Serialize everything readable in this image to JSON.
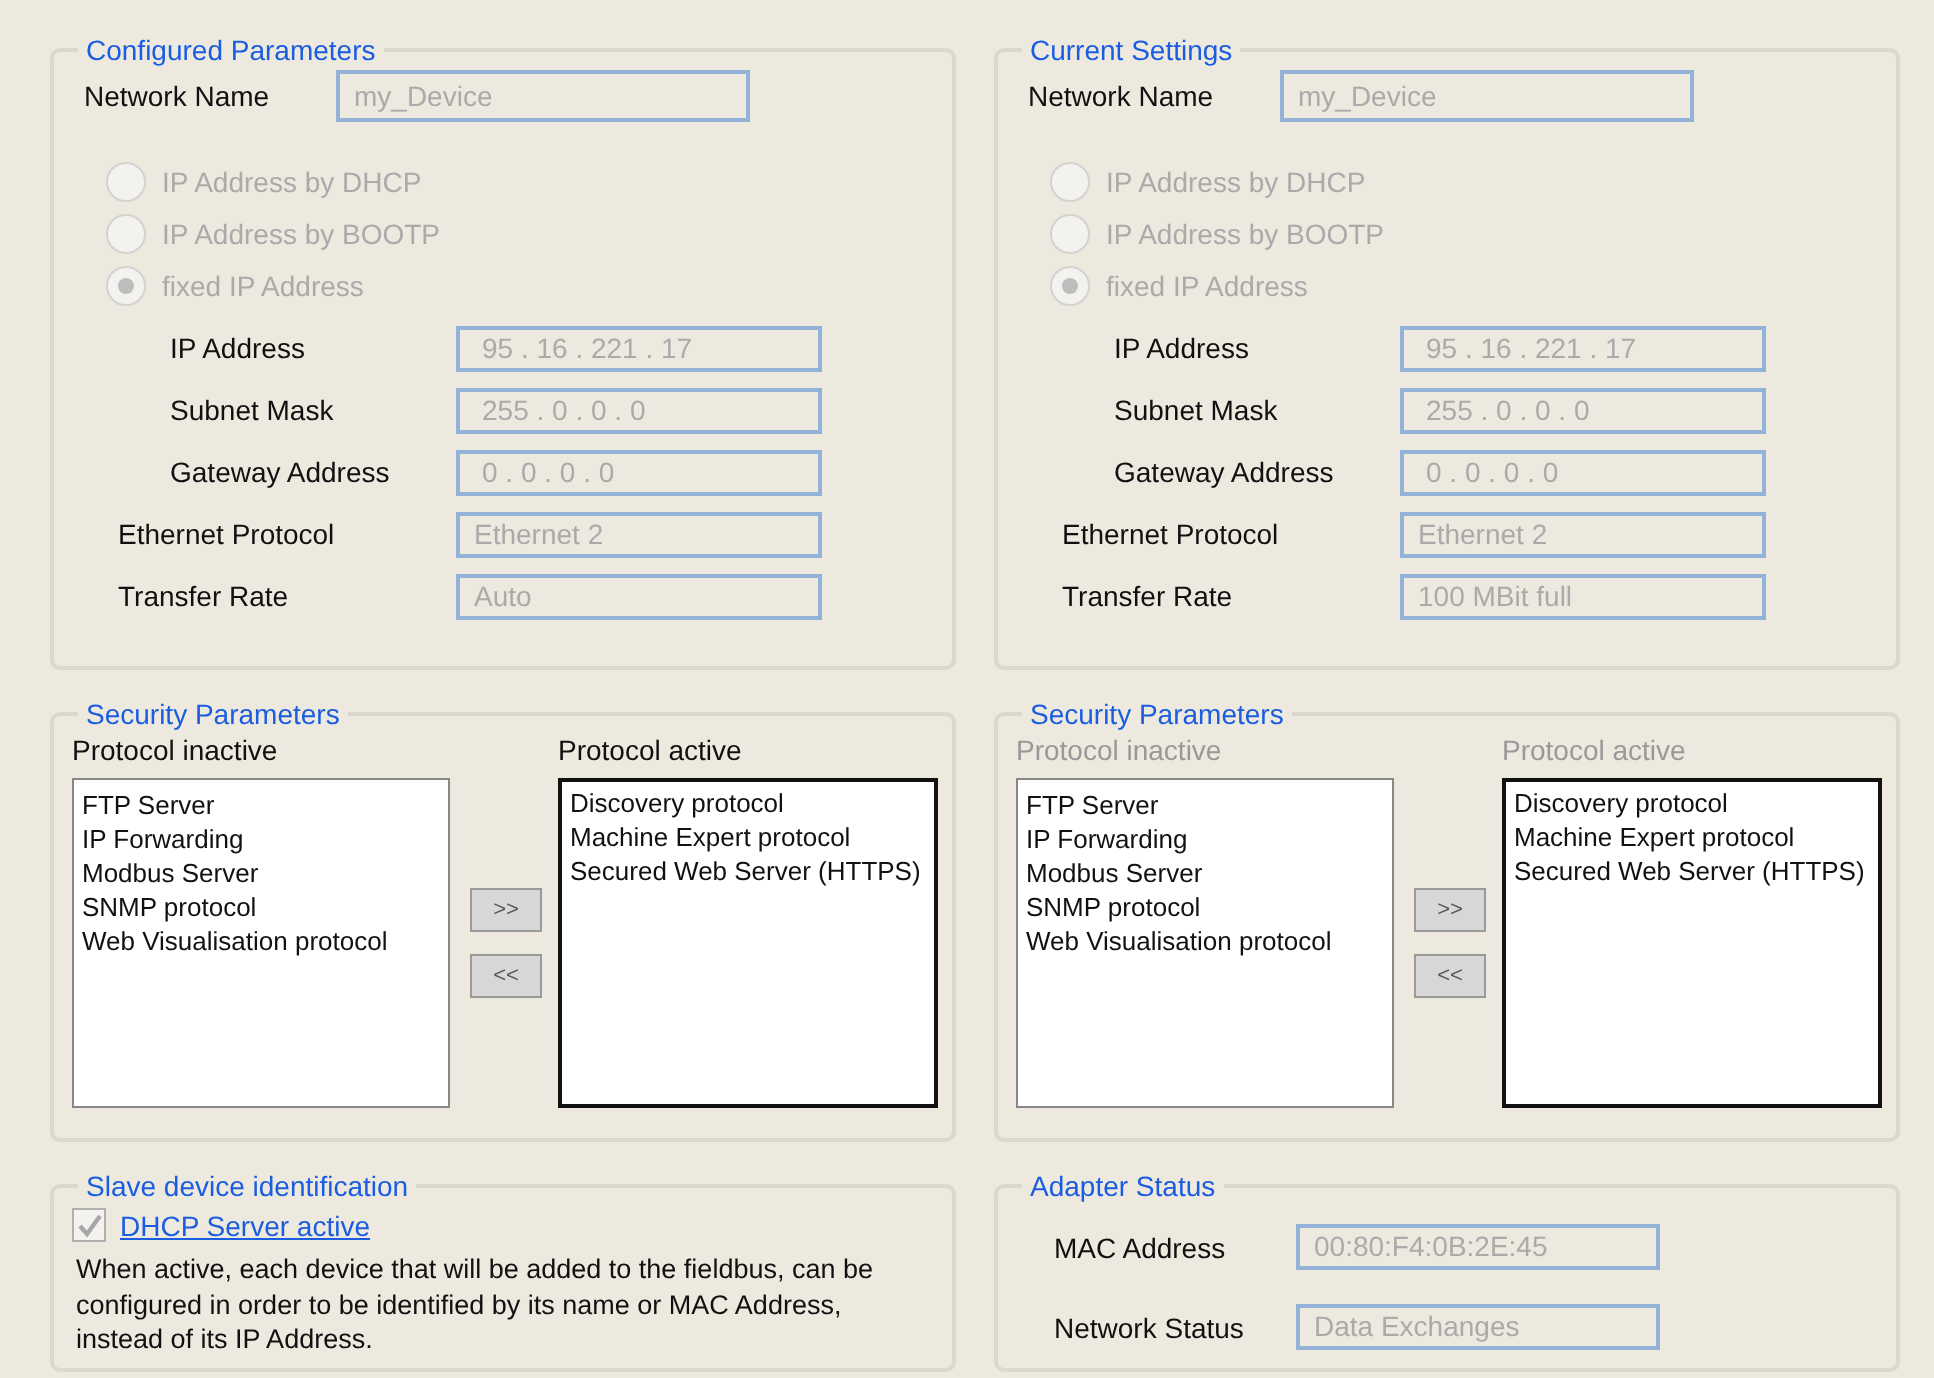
{
  "settings": [
    {
      "title": "Configured Parameters",
      "network_name": {
        "label": "Network Name",
        "value": "my_Device"
      },
      "ip_modes": [
        {
          "label": "IP Address by DHCP",
          "selected": false,
          "disabled": true
        },
        {
          "label": "IP Address by BOOTP",
          "selected": false,
          "disabled": true
        },
        {
          "label": "fixed IP Address",
          "selected": true,
          "disabled": true
        }
      ],
      "fields": [
        {
          "kind": "ip",
          "label": "IP Address",
          "value": "95 . 16 . 221 . 17"
        },
        {
          "kind": "ip",
          "label": "Subnet Mask",
          "value": "255 . 0 . 0 . 0"
        },
        {
          "kind": "ip",
          "label": "Gateway Address",
          "value": "0 . 0 . 0 . 0"
        },
        {
          "kind": "text",
          "label": "Ethernet Protocol",
          "value": "Ethernet 2"
        },
        {
          "kind": "text",
          "label": "Transfer Rate",
          "value": "Auto"
        }
      ]
    },
    {
      "title": "Current Settings",
      "network_name": {
        "label": "Network Name",
        "value": "my_Device"
      },
      "ip_modes": [
        {
          "label": "IP Address by DHCP",
          "selected": false,
          "disabled": true
        },
        {
          "label": "IP Address by BOOTP",
          "selected": false,
          "disabled": true
        },
        {
          "label": "fixed IP Address",
          "selected": true,
          "disabled": true
        }
      ],
      "fields": [
        {
          "kind": "ip",
          "label": "IP Address",
          "value": "95 . 16 . 221 . 17"
        },
        {
          "kind": "ip",
          "label": "Subnet Mask",
          "value": "255 . 0 . 0 . 0"
        },
        {
          "kind": "ip",
          "label": "Gateway Address",
          "value": "0 . 0 . 0 . 0"
        },
        {
          "kind": "text",
          "label": "Ethernet Protocol",
          "value": "Ethernet 2"
        },
        {
          "kind": "text",
          "label": "Transfer Rate",
          "value": "100 MBit full"
        }
      ]
    }
  ],
  "security": [
    {
      "title": "Security Parameters",
      "disabled": false,
      "inactive_label": "Protocol inactive",
      "active_label": "Protocol active",
      "inactive": [
        "FTP Server",
        "IP Forwarding",
        "Modbus Server",
        "SNMP protocol",
        "Web Visualisation protocol"
      ],
      "active": [
        "Discovery protocol",
        "Machine Expert protocol",
        "Secured Web Server (HTTPS)"
      ],
      "add_button": ">>",
      "remove_button": "<<"
    },
    {
      "title": "Security Parameters",
      "disabled": true,
      "inactive_label": "Protocol inactive",
      "active_label": "Protocol active",
      "inactive": [
        "FTP Server",
        "IP Forwarding",
        "Modbus Server",
        "SNMP protocol",
        "Web Visualisation protocol"
      ],
      "active": [
        "Discovery protocol",
        "Machine Expert protocol",
        "Secured Web Server (HTTPS)"
      ],
      "add_button": ">>",
      "remove_button": "<<"
    }
  ],
  "slave_identification": {
    "title": "Slave device identification",
    "dhcp_server": {
      "label": "DHCP Server active",
      "checked": true,
      "disabled": true
    },
    "description": "When active, each device that will be added to the fieldbus, can be configured in order to be identified by its name or MAC Address, instead of its IP Address."
  },
  "adapter_status": {
    "title": "Adapter Status",
    "fields": [
      {
        "label": "MAC Address",
        "value": "00:80:F4:0B:2E:45"
      },
      {
        "label": "Network Status",
        "value": "Data Exchanges"
      }
    ]
  }
}
